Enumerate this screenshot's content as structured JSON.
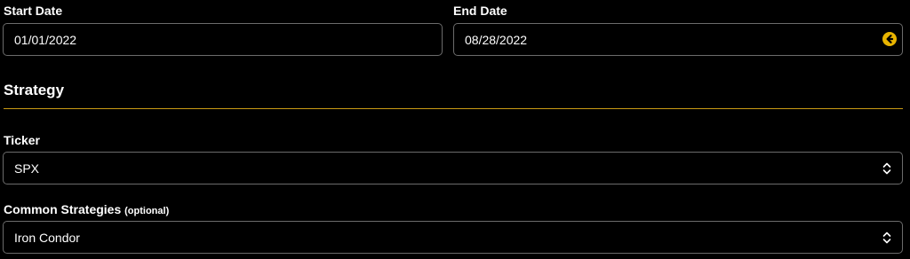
{
  "dates": {
    "start": {
      "label": "Start Date",
      "value": "01/01/2022"
    },
    "end": {
      "label": "End Date",
      "value": "08/28/2022",
      "icon": "arrow-left-circle-icon"
    }
  },
  "strategy": {
    "title": "Strategy",
    "ticker": {
      "label": "Ticker",
      "value": "SPX"
    },
    "common": {
      "label": "Common Strategies",
      "optional_label": "(optional)",
      "value": "Iron Condor"
    }
  },
  "colors": {
    "accent": "#e8b400",
    "divider": "#c89a14",
    "border": "#6b6b6b",
    "background": "#000000"
  }
}
